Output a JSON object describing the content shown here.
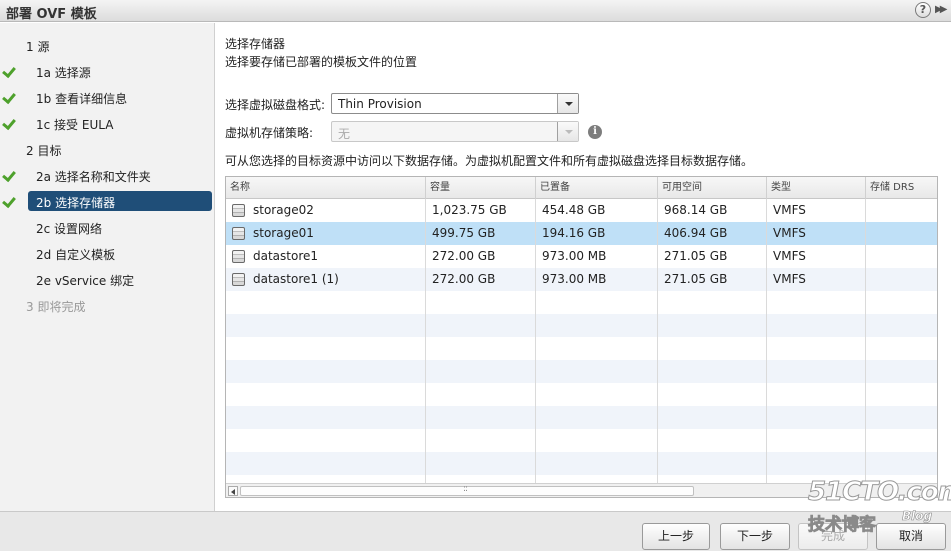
{
  "window": {
    "title": "部署 OVF 模板",
    "help_label": "?",
    "expand_label": "▶▶"
  },
  "sidebar": {
    "steps": [
      {
        "label": "1  源",
        "level": "top",
        "done": false,
        "state": "normal"
      },
      {
        "label": "1a  选择源",
        "level": "sub",
        "done": true,
        "state": "normal"
      },
      {
        "label": "1b  查看详细信息",
        "level": "sub",
        "done": true,
        "state": "normal"
      },
      {
        "label": "1c  接受 EULA",
        "level": "sub",
        "done": true,
        "state": "normal"
      },
      {
        "label": "2  目标",
        "level": "top",
        "done": false,
        "state": "normal"
      },
      {
        "label": "2a  选择名称和文件夹",
        "level": "sub",
        "done": true,
        "state": "normal"
      },
      {
        "label": "2b  选择存储器",
        "level": "sub",
        "done": true,
        "state": "selected"
      },
      {
        "label": "2c  设置网络",
        "level": "sub",
        "done": false,
        "state": "normal"
      },
      {
        "label": "2d  自定义模板",
        "level": "sub",
        "done": false,
        "state": "normal"
      },
      {
        "label": "2e  vService 绑定",
        "level": "sub",
        "done": false,
        "state": "normal"
      },
      {
        "label": "3  即将完成",
        "level": "top",
        "done": false,
        "state": "disabled"
      }
    ]
  },
  "main": {
    "heading": "选择存储器",
    "subheading": "选择要存储已部署的模板文件的位置",
    "disk_format": {
      "label": "选择虚拟磁盘格式:",
      "value": "Thin Provision"
    },
    "storage_policy": {
      "label": "虚拟机存储策略:",
      "value": "无",
      "disabled": true
    },
    "info_icon": "i",
    "description": "可从您选择的目标资源中访问以下数据存储。为虚拟机配置文件和所有虚拟磁盘选择目标数据存储。",
    "table": {
      "columns": [
        "名称",
        "容量",
        "已置备",
        "可用空间",
        "类型",
        "存储 DRS"
      ],
      "rows": [
        {
          "name": "storage02",
          "capacity": "1,023.75 GB",
          "provisioned": "454.48 GB",
          "free": "968.14 GB",
          "type": "VMFS",
          "drs": "",
          "selected": false
        },
        {
          "name": "storage01",
          "capacity": "499.75 GB",
          "provisioned": "194.16 GB",
          "free": "406.94 GB",
          "type": "VMFS",
          "drs": "",
          "selected": true
        },
        {
          "name": "datastore1",
          "capacity": "272.00 GB",
          "provisioned": "973.00 MB",
          "free": "271.05 GB",
          "type": "VMFS",
          "drs": "",
          "selected": false
        },
        {
          "name": "datastore1 (1)",
          "capacity": "272.00 GB",
          "provisioned": "973.00 MB",
          "free": "271.05 GB",
          "type": "VMFS",
          "drs": "",
          "selected": false
        }
      ],
      "scroll_grip": "::"
    }
  },
  "footer": {
    "back_label": "上一步",
    "next_label": "下一步",
    "finish_label": "完成",
    "cancel_label": "取消"
  },
  "watermark": {
    "site": "51CTO.com",
    "tagline": "技术博客",
    "blog": "Blog"
  },
  "colors": {
    "selected_step_bg": "#1f4e78",
    "selected_row_bg": "#bfe0f7",
    "check_green": "#4ea12c"
  }
}
